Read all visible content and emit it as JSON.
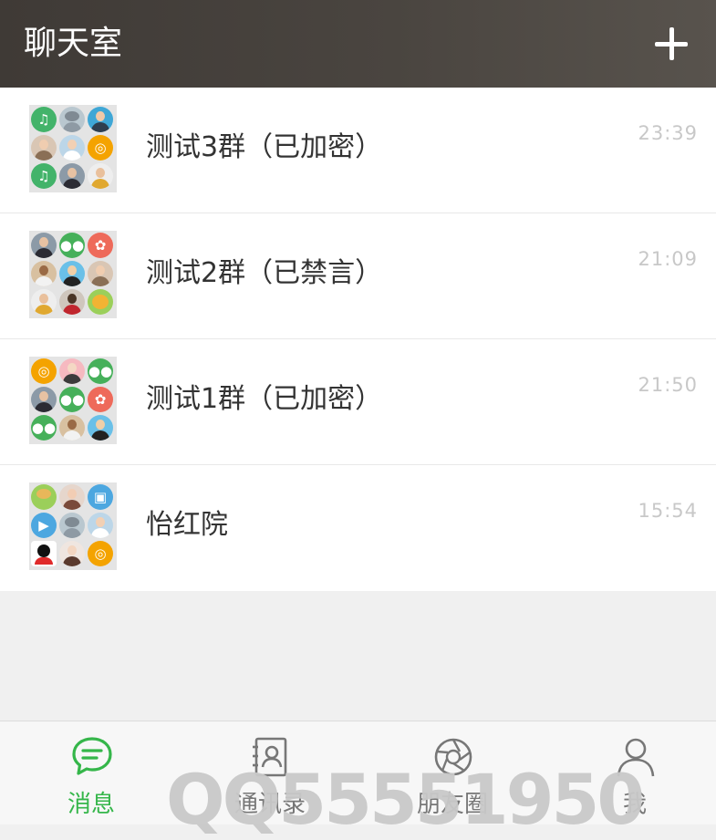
{
  "header": {
    "title": "聊天室",
    "add_icon": "plus-icon"
  },
  "chats": [
    {
      "name": "测试3群（已加密）",
      "time": "23:39",
      "avatars": [
        "music-icon-green",
        "hippo-avatar",
        "woman-avatar",
        "hat-woman-avatar",
        "man-avatar",
        "target-icon-orange",
        "music-icon-green",
        "woman-avatar-dark",
        "man-jacket-avatar"
      ]
    },
    {
      "name": "测试2群（已禁言）",
      "time": "21:09",
      "avatars": [
        "woman-avatar-dark",
        "wechat-icon-green",
        "film-icon-red",
        "woman-avatar",
        "man-sunglasses-avatar",
        "hat-woman-avatar",
        "man-jacket-avatar",
        "woman-red-avatar",
        "lion-avatar"
      ]
    },
    {
      "name": "测试1群（已加密）",
      "time": "21:50",
      "avatars": [
        "target-icon-orange",
        "woman-pink-avatar",
        "wechat-icon-green",
        "woman-avatar-dark",
        "wechat-icon-green",
        "film-icon-red",
        "wechat-icon-green",
        "woman-avatar",
        "man-sunglasses-avatar"
      ]
    },
    {
      "name": "怡红院",
      "time": "15:54",
      "avatars": [
        "giraffe-avatar",
        "woman-avatar",
        "image-icon-blue",
        "video-icon-blue",
        "hippo-avatar",
        "man-avatar",
        "qq-penguin-icon",
        "woman-avatar-light",
        "target-icon-orange"
      ]
    }
  ],
  "tabbar": {
    "tabs": [
      {
        "label": "消息",
        "icon": "chat-bubble-icon",
        "active": true
      },
      {
        "label": "通讯录",
        "icon": "contacts-book-icon",
        "active": false
      },
      {
        "label": "朋友圈",
        "icon": "camera-aperture-icon",
        "active": false
      },
      {
        "label": "我",
        "icon": "person-icon",
        "active": false
      }
    ]
  },
  "watermark": "QQ55551950",
  "colors": {
    "accent": "#35b64a",
    "header_bg": "#4a4540",
    "time": "#c8c8c8"
  }
}
